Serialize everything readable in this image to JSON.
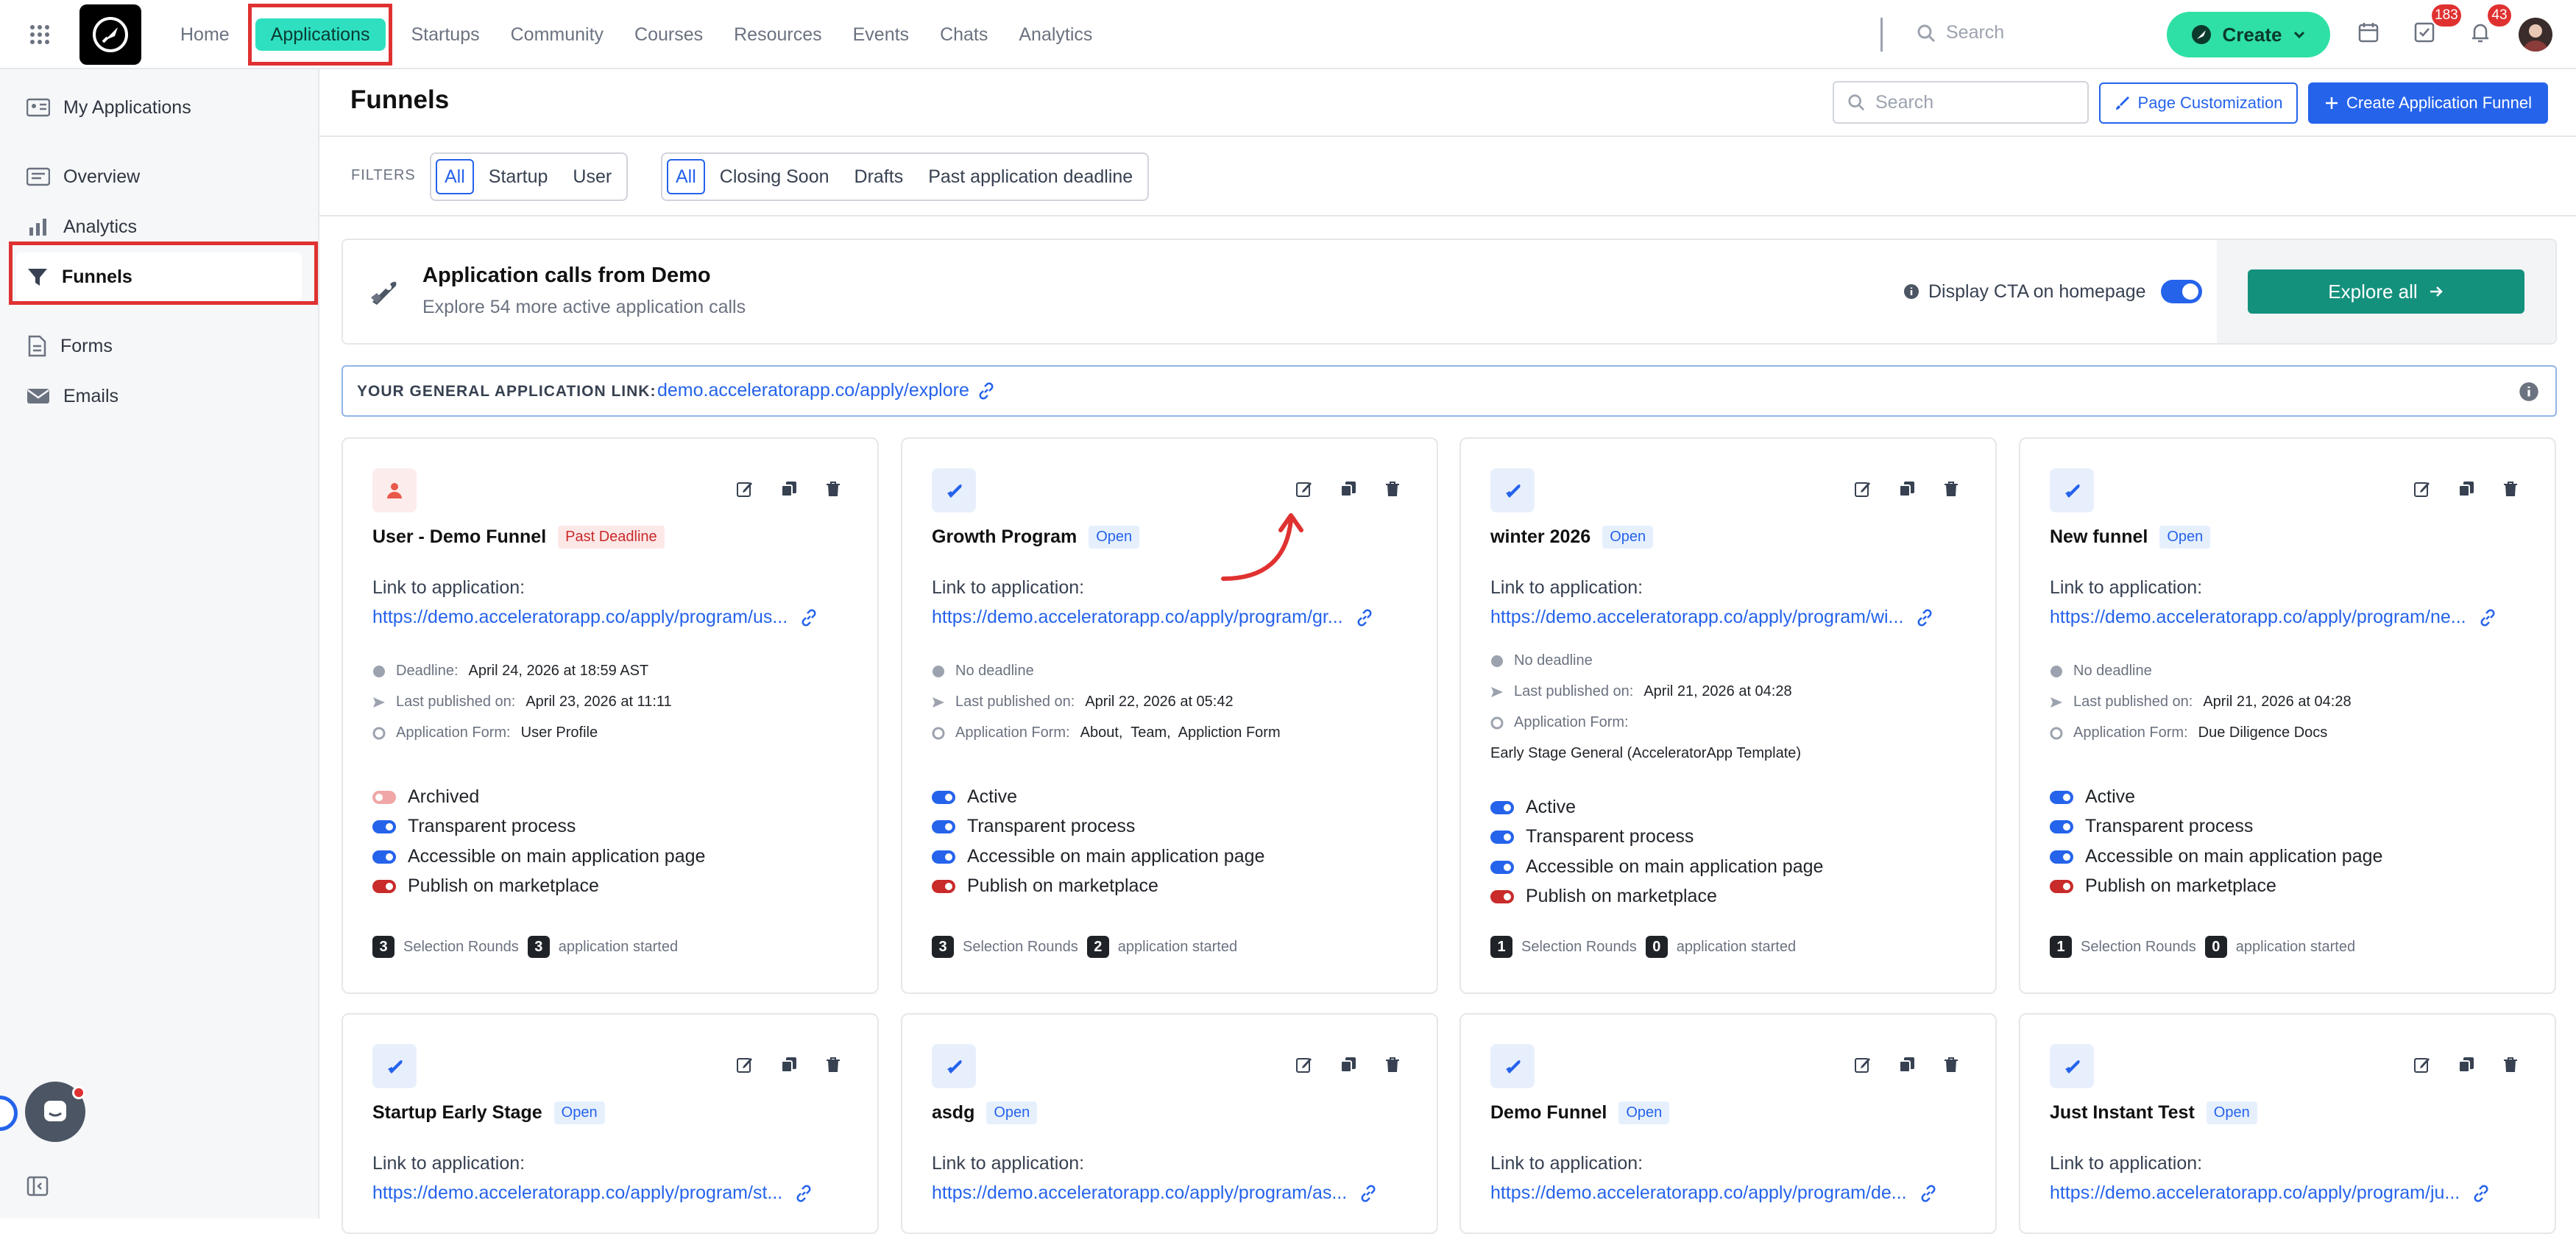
{
  "nav": {
    "items": [
      "Home",
      "Applications",
      "Startups",
      "Community",
      "Courses",
      "Resources",
      "Events",
      "Chats",
      "Analytics"
    ],
    "search_placeholder": "Search",
    "create_label": "Create",
    "tasks_badge": "183",
    "notif_badge": "43"
  },
  "sidebar": {
    "items": [
      "My Applications",
      "Overview",
      "Analytics",
      "Funnels",
      "Forms",
      "Emails"
    ]
  },
  "header": {
    "title": "Funnels",
    "search_placeholder": "Search",
    "page_customization": "Page Customization",
    "create_funnel": "Create Application Funnel"
  },
  "filters": {
    "label": "FILTERS",
    "group1": [
      "All",
      "Startup",
      "User"
    ],
    "group2": [
      "All",
      "Closing Soon",
      "Drafts",
      "Past application deadline"
    ]
  },
  "calls": {
    "title": "Application calls from Demo",
    "subtitle": "Explore 54 more active application calls",
    "cta_label": "Display CTA on homepage",
    "explore": "Explore all"
  },
  "general_link": {
    "label": "YOUR GENERAL APPLICATION LINK:",
    "url": "demo.acceleratorapp.co/apply/explore"
  },
  "link_label": "Link to application:",
  "labels": {
    "deadline": "Deadline:",
    "no_deadline": "No deadline",
    "last_published": "Last published on:",
    "app_form": "Application Form:",
    "selection_rounds": "Selection Rounds",
    "application_started": "application started"
  },
  "cards": [
    {
      "name": "User - Demo Funnel",
      "status": "Past Deadline",
      "url": "https://demo.acceleratorapp.co/apply/program/us...",
      "deadline": "April 24, 2026 at 18:59 AST",
      "published": "April 23, 2026 at 11:11",
      "form": "User Profile",
      "switches": [
        "Archived",
        "Transparent process",
        "Accessible on main application page",
        "Publish on marketplace"
      ],
      "rounds": "3",
      "started": "3"
    },
    {
      "name": "Growth Program",
      "status": "Open",
      "url": "https://demo.acceleratorapp.co/apply/program/gr...",
      "deadline": "",
      "published": "April 22, 2026 at 05:42",
      "form": "About,  Team,  Appliction Form",
      "switches": [
        "Active",
        "Transparent process",
        "Accessible on main application page",
        "Publish on marketplace"
      ],
      "rounds": "3",
      "started": "2"
    },
    {
      "name": "winter 2026",
      "status": "Open",
      "url": "https://demo.acceleratorapp.co/apply/program/wi...",
      "deadline": "",
      "published": "April 21, 2026 at 04:28",
      "form": "Early Stage General (AcceleratorApp Template)",
      "switches": [
        "Active",
        "Transparent process",
        "Accessible on main application page",
        "Publish on marketplace"
      ],
      "rounds": "1",
      "started": "0"
    },
    {
      "name": "New funnel",
      "status": "Open",
      "url": "https://demo.acceleratorapp.co/apply/program/ne...",
      "deadline": "",
      "published": "April 21, 2026 at 04:28",
      "form": "Due Diligence Docs",
      "switches": [
        "Active",
        "Transparent process",
        "Accessible on main application page",
        "Publish on marketplace"
      ],
      "rounds": "1",
      "started": "0"
    },
    {
      "name": "Startup Early Stage",
      "status": "Open",
      "url": "https://demo.acceleratorapp.co/apply/program/st..."
    },
    {
      "name": "asdg",
      "status": "Open",
      "url": "https://demo.acceleratorapp.co/apply/program/as..."
    },
    {
      "name": "Demo Funnel",
      "status": "Open",
      "url": "https://demo.acceleratorapp.co/apply/program/de..."
    },
    {
      "name": "Just Instant Test",
      "status": "Open",
      "url": "https://demo.acceleratorapp.co/apply/program/ju..."
    }
  ],
  "colors": {
    "accent": "#2563eb",
    "brand_teal": "#2fe0c0",
    "explore_btn": "#14917d",
    "highlight": "#e03131"
  }
}
